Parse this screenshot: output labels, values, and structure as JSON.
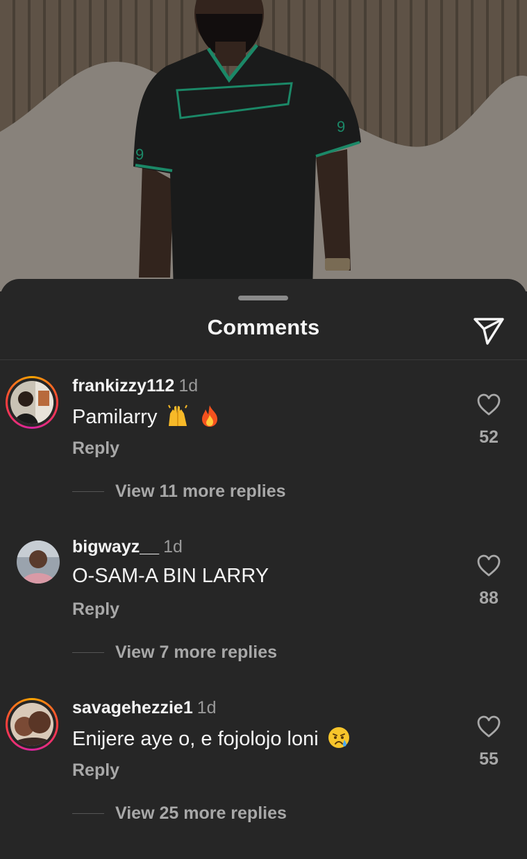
{
  "sheet": {
    "title": "Comments",
    "share_icon": "paper-plane-icon"
  },
  "comments": [
    {
      "username": "frankizzy112",
      "time": "1d",
      "text": "Pamilarry",
      "emojis": [
        "raising-hands-emoji",
        "fire-emoji"
      ],
      "reply_label": "Reply",
      "view_replies": "View 11 more replies",
      "likes": "52",
      "avatar_ring": true
    },
    {
      "username": "bigwayz__",
      "time": "1d",
      "text": "O-SAM-A BIN LARRY",
      "emojis": [],
      "reply_label": "Reply",
      "view_replies": "View 7 more replies",
      "likes": "88",
      "avatar_ring": false
    },
    {
      "username": "savagehezzie1",
      "time": "1d",
      "text": "Enijere aye o, e fojolojo loni",
      "emojis": [
        "crying-face-emoji"
      ],
      "reply_label": "Reply",
      "view_replies": "View 25 more replies",
      "likes": "55",
      "avatar_ring": true
    }
  ],
  "colors": {
    "sheet_background": "#262626",
    "primary_text": "#f5f5f5",
    "secondary_text": "#a8a8a8",
    "story_ring": [
      "#f9a400",
      "#ff3d3d",
      "#d6249f"
    ]
  }
}
